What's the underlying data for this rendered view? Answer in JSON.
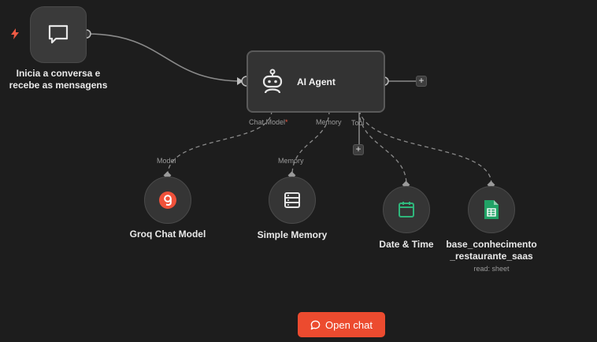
{
  "trigger": {
    "label_line1": "Inicia a conversa e",
    "label_line2": "recebe as mensagens",
    "icon": "chat-bubble-icon"
  },
  "agent": {
    "title": "AI Agent",
    "ports": {
      "chat_model": "Chat Model",
      "required_mark": "*",
      "memory": "Memory",
      "tool": "Tool"
    }
  },
  "nodes": {
    "groq": {
      "label": "Groq Chat Model",
      "port_label": "Model",
      "icon": "groq-icon"
    },
    "memory": {
      "label": "Simple Memory",
      "port_label": "Memory",
      "icon": "database-icon"
    },
    "datetime": {
      "label": "Date & Time",
      "icon": "calendar-icon"
    },
    "sheet": {
      "label_line1": "base_conhecimento",
      "label_line2": "_restaurante_saas",
      "sublabel": "read: sheet",
      "icon": "google-sheets-icon"
    }
  },
  "plus_symbol": "+",
  "open_chat": {
    "label": "Open chat",
    "icon": "chat-icon"
  },
  "colors": {
    "accent": "#ec4b2f",
    "background": "#1d1d1d",
    "node": "#353535",
    "groq_red": "#f0513a",
    "calendar_green": "#2fb67b",
    "sheets_green": "#21a366"
  }
}
